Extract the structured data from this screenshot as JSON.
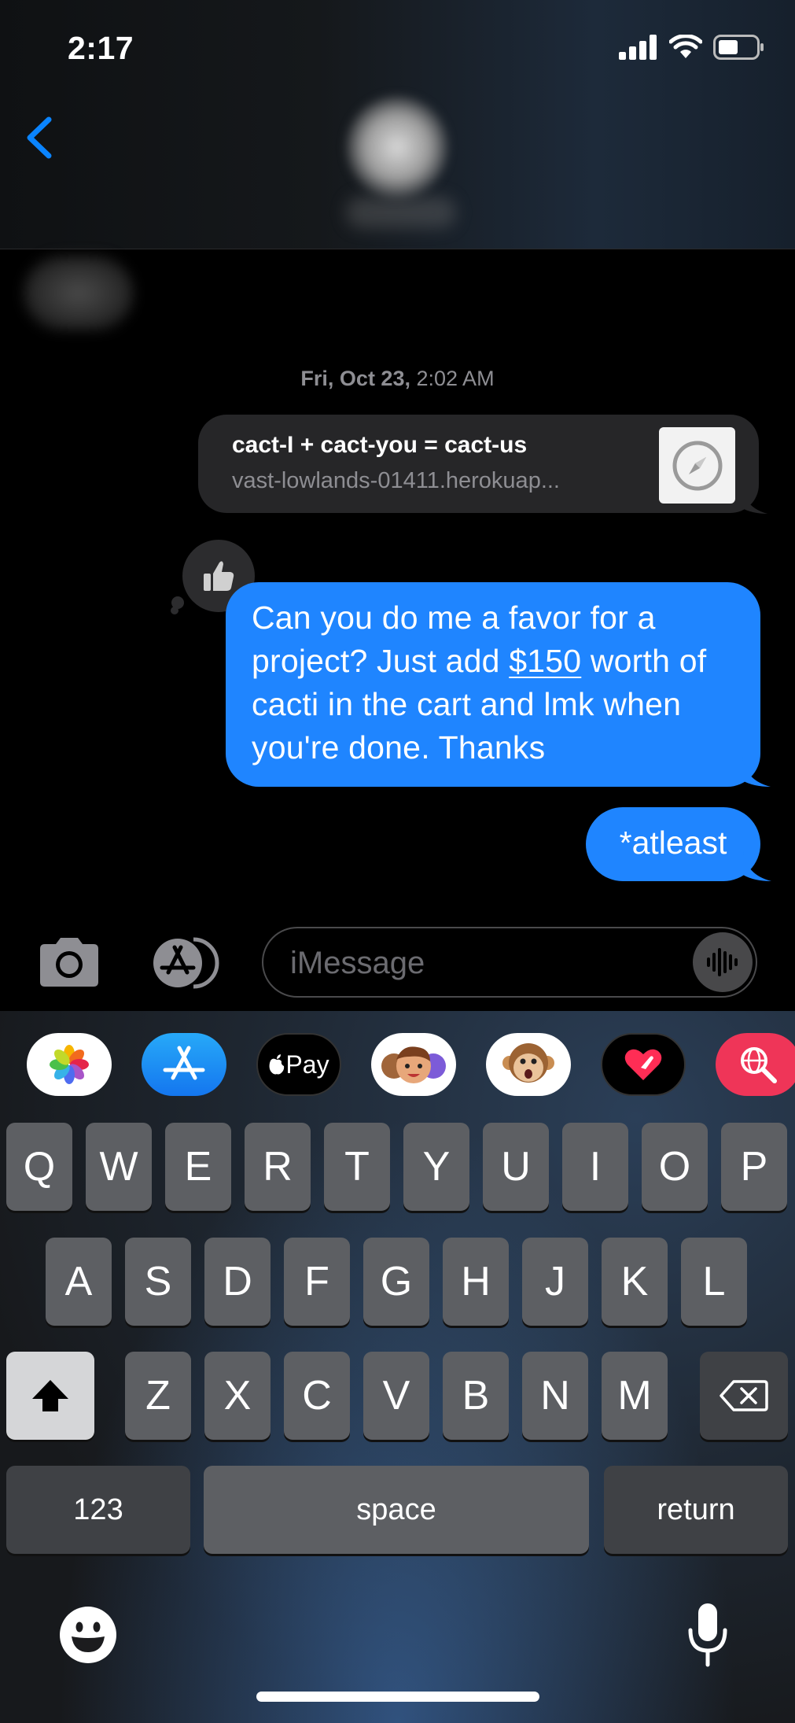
{
  "status_bar": {
    "time": "2:17"
  },
  "conversation": {
    "timestamp_day": "Fri, Oct 23,",
    "timestamp_time": "2:02 AM",
    "link_preview": {
      "title": "cact-I + cact-you = cact-us",
      "url": "vast-lowlands-01411.herokuap..."
    },
    "tapback_icon": "thumbs-up-icon",
    "messages": [
      {
        "text_before": "Can you do me a favor for a project? Just add ",
        "amount": "$150",
        "text_after": " worth of cacti in the cart and lmk when you're done. Thanks"
      },
      {
        "text": "*atleast"
      }
    ]
  },
  "input_bar": {
    "placeholder": "iMessage"
  },
  "app_drawer": [
    "photos-app-icon",
    "app-store-icon",
    "apple-pay-icon",
    "memoji-icon",
    "animoji-icon",
    "digital-touch-icon",
    "image-search-icon"
  ],
  "apple_pay_label": "Pay",
  "keyboard": {
    "row1": [
      "Q",
      "W",
      "E",
      "R",
      "T",
      "Y",
      "U",
      "I",
      "O",
      "P"
    ],
    "row2": [
      "A",
      "S",
      "D",
      "F",
      "G",
      "H",
      "J",
      "K",
      "L"
    ],
    "row3": [
      "Z",
      "X",
      "C",
      "V",
      "B",
      "N",
      "M"
    ],
    "numbers_label": "123",
    "space_label": "space",
    "return_label": "return"
  },
  "colors": {
    "imessage_blue": "#1f85ff",
    "received_bubble": "#262628",
    "ios_link_blue": "#0a84ff"
  }
}
